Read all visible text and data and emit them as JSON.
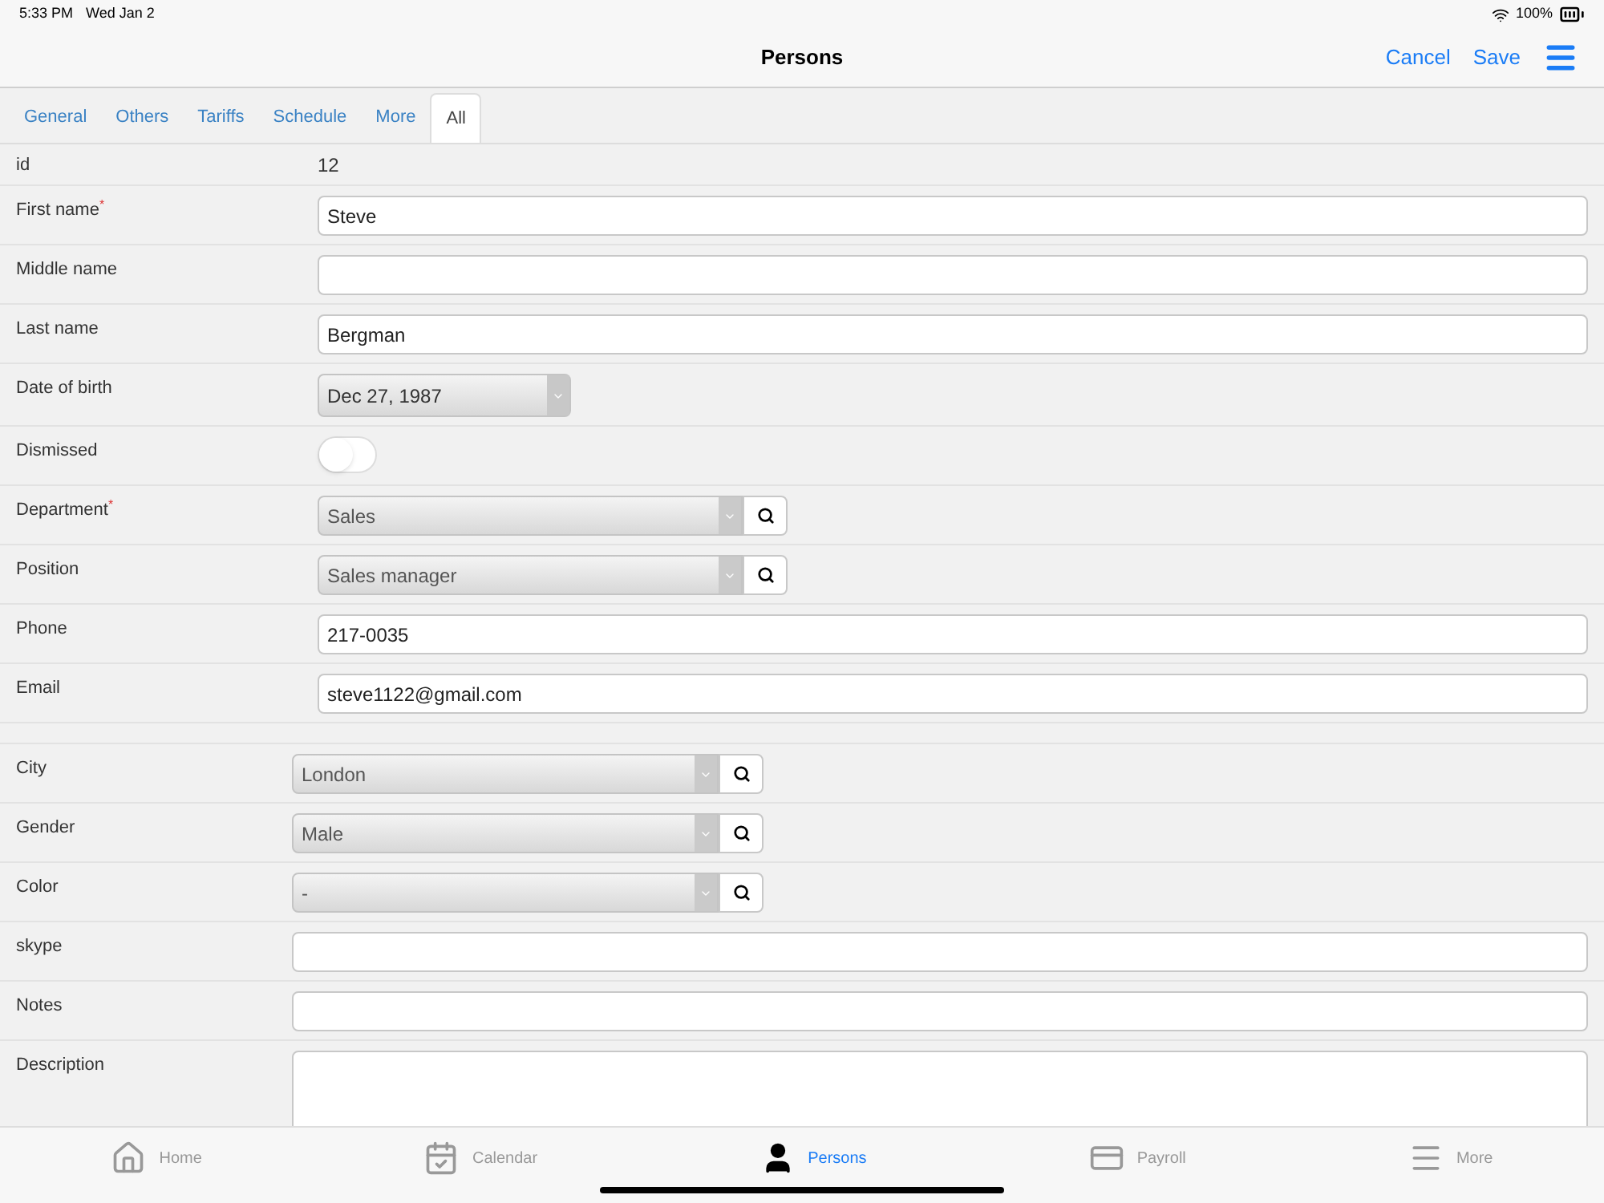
{
  "status_bar": {
    "time": "5:33 PM",
    "date": "Wed Jan 2",
    "battery": "100%"
  },
  "nav": {
    "title": "Persons",
    "actions": [
      "Cancel",
      "Save"
    ]
  },
  "tabs": [
    {
      "label": "General",
      "selected": false
    },
    {
      "label": "Others",
      "selected": false
    },
    {
      "label": "Tariffs",
      "selected": false
    },
    {
      "label": "Schedule",
      "selected": false
    },
    {
      "label": "More",
      "selected": false
    },
    {
      "label": "All",
      "selected": true
    }
  ],
  "sections": [
    {
      "fields": [
        {
          "label": "id",
          "kind": "text",
          "value": "12"
        },
        {
          "label": "First name",
          "kind": "input",
          "value": "Steve",
          "required_mark": "*"
        },
        {
          "label": "Middle name",
          "kind": "input"
        },
        {
          "label": "Last name",
          "kind": "input",
          "value": "Bergman"
        },
        {
          "label": "Date of birth",
          "kind": "date",
          "value": "Dec 27, 1987"
        },
        {
          "label": "Dismissed",
          "kind": "toggle",
          "on": false
        },
        {
          "label": "Department",
          "kind": "select",
          "value": "Sales",
          "required_mark": "*"
        },
        {
          "label": "Position",
          "kind": "select",
          "value": "Sales manager"
        },
        {
          "label": "Phone",
          "kind": "input",
          "value": "217-0035"
        },
        {
          "label": "Email",
          "kind": "input",
          "value": "steve1122@gmail.com"
        }
      ]
    },
    {
      "fields": [
        {
          "label": "City",
          "kind": "select",
          "value": "London"
        },
        {
          "label": "Gender",
          "kind": "select",
          "value": "Male"
        },
        {
          "label": "Color",
          "kind": "select",
          "value": "-"
        },
        {
          "label": "skype",
          "kind": "input"
        },
        {
          "label": "Notes",
          "kind": "input"
        },
        {
          "label": "Description",
          "kind": "textarea"
        }
      ]
    }
  ],
  "tab_bar": [
    {
      "label": "Home",
      "selected": false
    },
    {
      "label": "Calendar",
      "selected": false
    },
    {
      "label": "Persons",
      "selected": true
    },
    {
      "label": "Payroll",
      "selected": false
    },
    {
      "label": "More",
      "selected": false
    }
  ]
}
